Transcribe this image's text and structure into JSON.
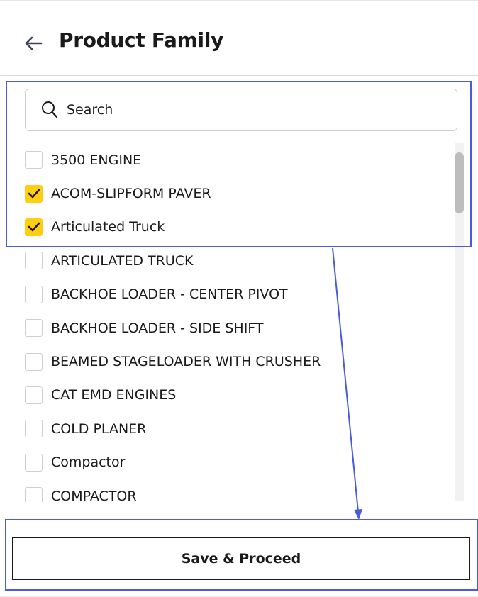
{
  "header": {
    "title": "Product Family",
    "back_icon": "arrow-left-icon"
  },
  "search": {
    "placeholder": "Search",
    "value": "",
    "icon": "search-icon"
  },
  "list": {
    "items": [
      {
        "label": "3500 ENGINE",
        "checked": false
      },
      {
        "label": "ACOM-SLIPFORM PAVER",
        "checked": true
      },
      {
        "label": "Articulated Truck",
        "checked": true
      },
      {
        "label": "ARTICULATED TRUCK",
        "checked": false
      },
      {
        "label": "BACKHOE LOADER - CENTER PIVOT",
        "checked": false
      },
      {
        "label": "BACKHOE LOADER - SIDE SHIFT",
        "checked": false
      },
      {
        "label": "BEAMED STAGELOADER WITH CRUSHER",
        "checked": false
      },
      {
        "label": "CAT EMD ENGINES",
        "checked": false
      },
      {
        "label": "COLD PLANER",
        "checked": false
      },
      {
        "label": "Compactor",
        "checked": false
      },
      {
        "label": "COMPACTOR",
        "checked": false
      }
    ]
  },
  "footer": {
    "save_label": "Save & Proceed"
  },
  "colors": {
    "checked_fill": "#ffcd11",
    "highlight": "#4a5bdc"
  }
}
